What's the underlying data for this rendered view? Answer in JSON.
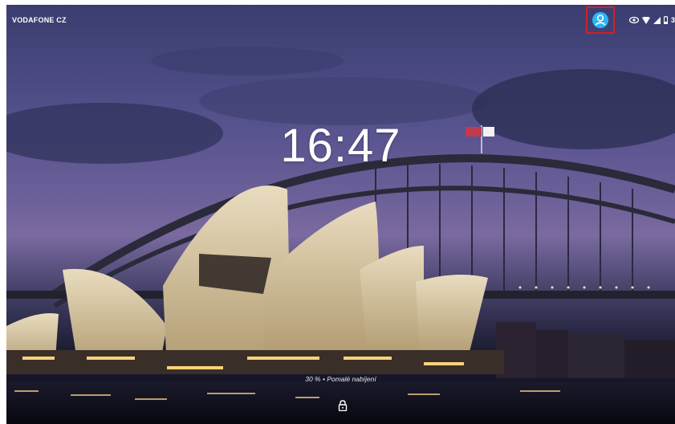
{
  "status_bar": {
    "carrier": "VODAFONE CZ",
    "battery_text": "30",
    "icons": [
      "user-account-icon",
      "eye-icon",
      "wifi-icon",
      "signal-icon",
      "battery-icon"
    ],
    "highlight_color": "#d0202a",
    "user_icon_color": "#29b6f6"
  },
  "lockscreen": {
    "time": "16:47",
    "charging_status": "30 % • Pomalé nabíjení",
    "icons": [
      "lock-icon"
    ]
  }
}
